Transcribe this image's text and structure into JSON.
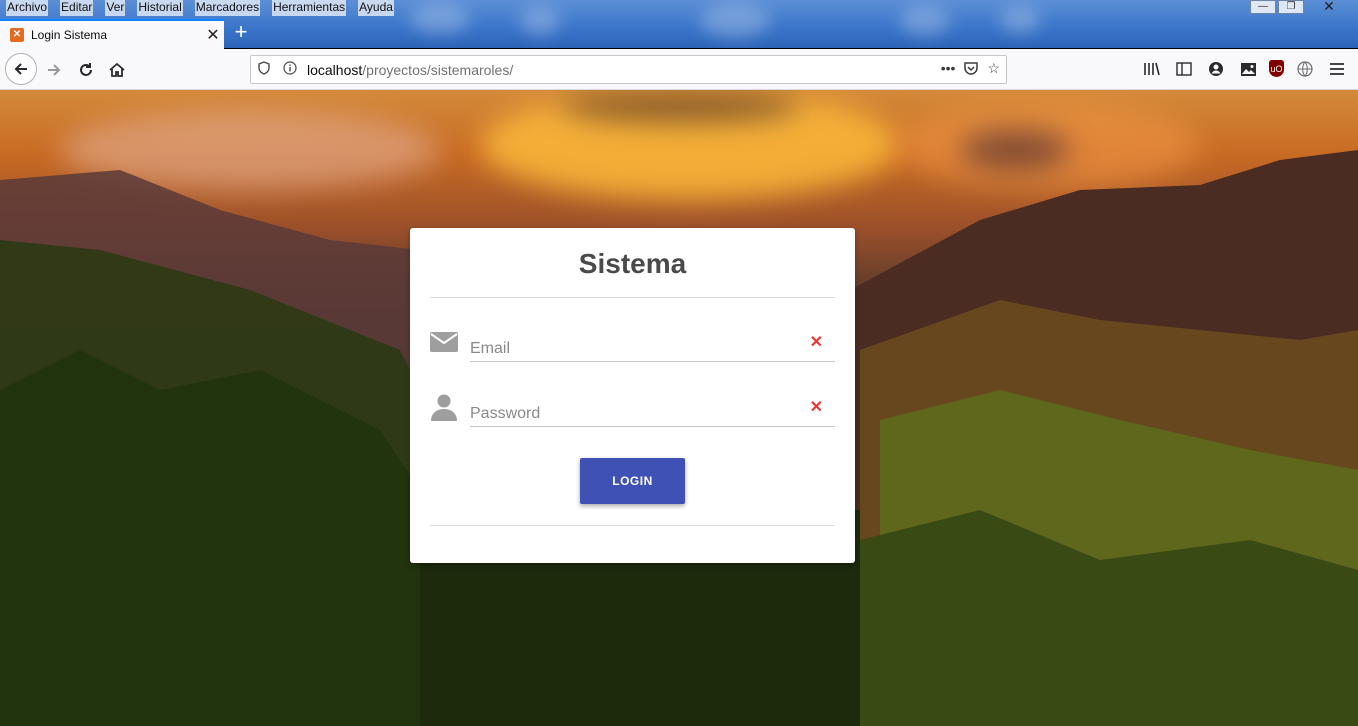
{
  "window": {
    "menu": [
      "Archivo",
      "Editar",
      "Ver",
      "Historial",
      "Marcadores",
      "Herramientas",
      "Ayuda"
    ],
    "controls": {
      "minimize": "—",
      "restore": "❐",
      "close": "✕"
    }
  },
  "tab": {
    "title": "Login Sistema",
    "favicon": "xampp-icon",
    "close": "✕",
    "new_tab": "+"
  },
  "navbar": {
    "url_host": "localhost",
    "url_path": "/proyectos/sistemaroles/",
    "icons": [
      "back-icon",
      "forward-icon",
      "reload-icon",
      "home-icon",
      "shield-icon",
      "info-icon",
      "more-icon",
      "pocket-icon",
      "star-icon",
      "library-icon",
      "sidebar-icon",
      "account-icon",
      "image-icon",
      "ublock-icon",
      "globe-icon",
      "menu-icon"
    ]
  },
  "login": {
    "title": "Sistema",
    "email_placeholder": "Email",
    "password_placeholder": "Password",
    "button_label": "LOGIN"
  },
  "colors": {
    "accent": "#3f51b5",
    "clear": "#e53935",
    "tab_highlight": "#0a84ff"
  }
}
